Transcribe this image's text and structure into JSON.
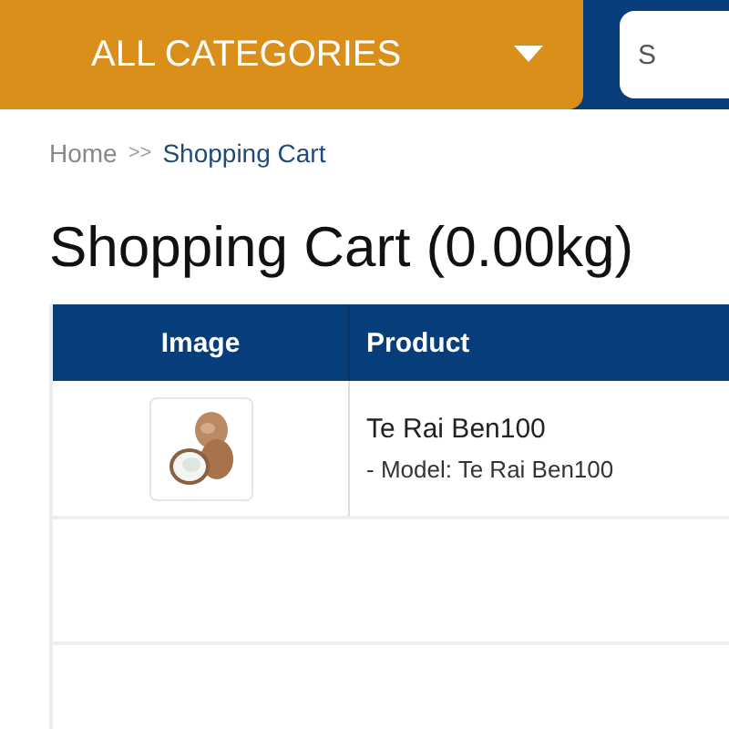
{
  "category_menu": {
    "label": "ALL CATEGORIES"
  },
  "search": {
    "placeholder": "S"
  },
  "breadcrumb": [
    {
      "label": "Home",
      "current": false
    },
    {
      "label": "Shopping Cart",
      "current": true
    }
  ],
  "breadcrumb_separator": ">>",
  "title": "Shopping Cart (0.00kg)",
  "table": {
    "columns": [
      "Image",
      "Product"
    ],
    "rows": [
      {
        "product": "Te Rai Ben100",
        "model": "- Model: Te Rai Ben100"
      }
    ]
  }
}
